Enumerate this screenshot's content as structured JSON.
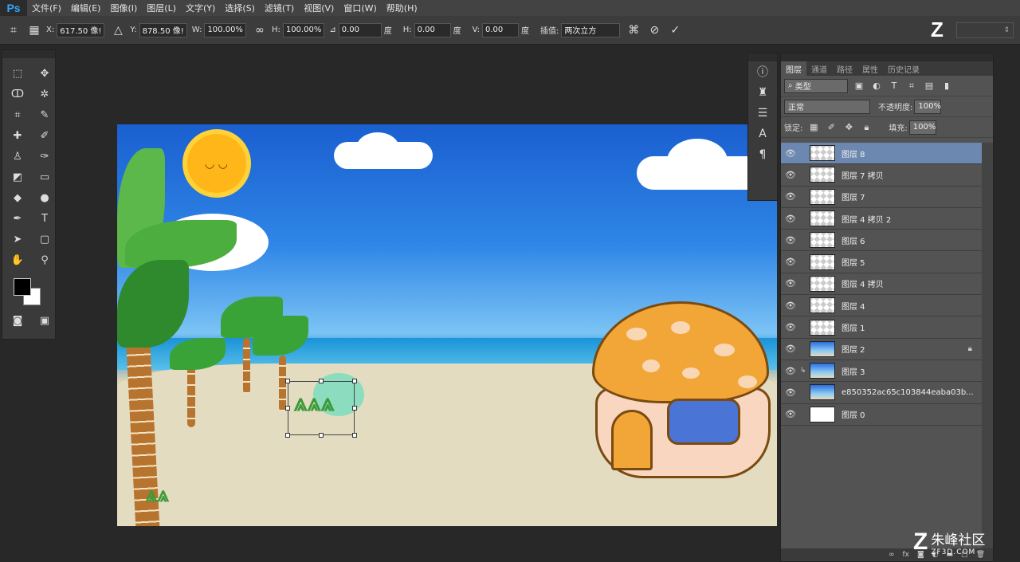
{
  "app": {
    "logo": "Ps"
  },
  "menu": [
    "文件(F)",
    "编辑(E)",
    "图像(I)",
    "图层(L)",
    "文字(Y)",
    "选择(S)",
    "滤镜(T)",
    "视图(V)",
    "窗口(W)",
    "帮助(H)"
  ],
  "options": {
    "x_label": "X:",
    "x_value": "617.50 像!",
    "y_label": "Y:",
    "y_value": "878.50 像!",
    "w_label": "W:",
    "w_value": "100.00%",
    "h_label": "H:",
    "h_value": "100.00%",
    "angle_value": "0.00",
    "angle_unit": "度",
    "hskew_label": "H:",
    "hskew_value": "0.00",
    "hskew_unit": "度",
    "vskew_label": "V:",
    "vskew_value": "0.00",
    "vskew_unit": "度",
    "interp_label": "插值:",
    "interp_value": "两次立方",
    "warp_icon": "warp-icon",
    "cancel_icon": "cancel-icon",
    "commit_icon": "commit-icon"
  },
  "layers_panel": {
    "tabs": [
      "图层",
      "通道",
      "路径",
      "属性",
      "历史记录"
    ],
    "filter_value": "类型",
    "blend_mode": "正常",
    "opacity_label": "不透明度:",
    "opacity_value": "100%",
    "lock_label": "锁定:",
    "fill_label": "填充:",
    "fill_value": "100%",
    "layers": [
      {
        "name": "图层 8",
        "selected": true,
        "thumb": "transparent"
      },
      {
        "name": "图层 7 拷贝",
        "thumb": "transparent"
      },
      {
        "name": "图层 7",
        "thumb": "transparent"
      },
      {
        "name": "图层 4 拷贝 2",
        "thumb": "transparent"
      },
      {
        "name": "图层 6",
        "thumb": "transparent"
      },
      {
        "name": "图层 5",
        "thumb": "transparent"
      },
      {
        "name": "图层 4 拷贝",
        "thumb": "transparent"
      },
      {
        "name": "图层 4",
        "thumb": "transparent"
      },
      {
        "name": "图层 1",
        "thumb": "transparent"
      },
      {
        "name": "图层 2",
        "thumb": "sky",
        "locked": true
      },
      {
        "name": "图层 3",
        "thumb": "sky",
        "clipped": true
      },
      {
        "name": "e850352ac65c103844eaba03b...",
        "thumb": "sky",
        "smart": true
      },
      {
        "name": "图层 0",
        "thumb": "white"
      }
    ]
  },
  "watermark": {
    "logo": "Z",
    "cn": "朱峰社区",
    "en": "ZF3D.COM"
  },
  "colors": {
    "accent": "#31a8ff",
    "selected_layer": "#6d88b0",
    "foreground": "#000000",
    "background": "#ffffff"
  }
}
